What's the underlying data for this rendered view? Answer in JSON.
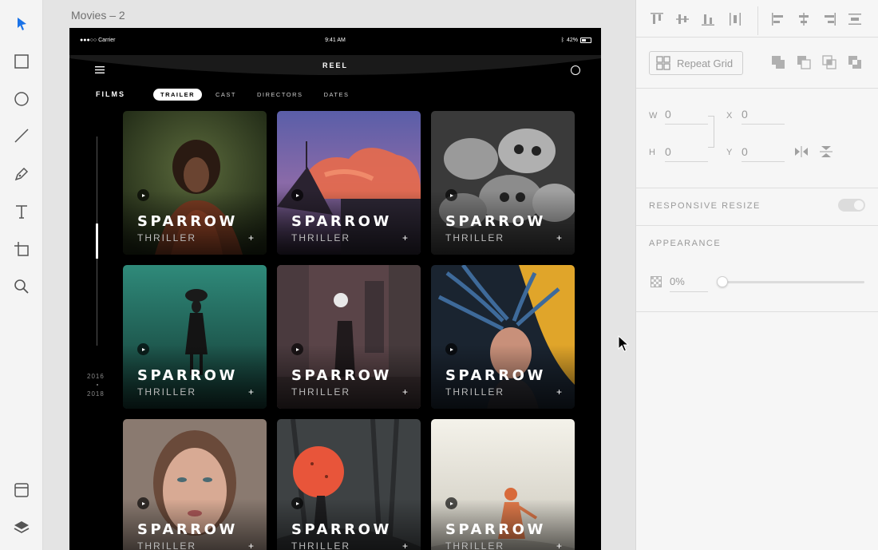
{
  "toolbar": {
    "tools": [
      {
        "name": "select-tool-icon",
        "active": true
      },
      {
        "name": "rectangle-tool-icon"
      },
      {
        "name": "ellipse-tool-icon"
      },
      {
        "name": "line-tool-icon"
      },
      {
        "name": "pen-tool-icon"
      },
      {
        "name": "text-tool-icon"
      },
      {
        "name": "artboard-tool-icon"
      },
      {
        "name": "zoom-tool-icon"
      }
    ],
    "bottom_tools": [
      {
        "name": "assets-panel-icon"
      },
      {
        "name": "layers-panel-icon"
      }
    ],
    "accent": "#1a73e8"
  },
  "canvas": {
    "artboard_title": "Movies – 2"
  },
  "app": {
    "status": {
      "carrier": "●●●○○ Carrier",
      "time": "9:41 AM",
      "battery": "42%"
    },
    "title": "REEL",
    "section_label": "FILMS",
    "tabs": [
      {
        "label": "TRAILER",
        "active": true
      },
      {
        "label": "CAST"
      },
      {
        "label": "DIRECTORS"
      },
      {
        "label": "DATES"
      }
    ],
    "timeline": {
      "start": "2016",
      "end": "2018"
    },
    "cards": [
      {
        "title": "SPARROW",
        "genre": "THRILLER",
        "plus": "+"
      },
      {
        "title": "SPARROW",
        "genre": "THRILLER",
        "plus": "+"
      },
      {
        "title": "SPARROW",
        "genre": "THRILLER",
        "plus": "+"
      },
      {
        "title": "SPARROW",
        "genre": "THRILLER",
        "plus": "+"
      },
      {
        "title": "SPARROW",
        "genre": "THRILLER",
        "plus": "+"
      },
      {
        "title": "SPARROW",
        "genre": "THRILLER",
        "plus": "+"
      },
      {
        "title": "SPARROW",
        "genre": "THRILLER",
        "plus": "+"
      },
      {
        "title": "SPARROW",
        "genre": "THRILLER",
        "plus": "+"
      },
      {
        "title": "SPARROW",
        "genre": "THRILLER",
        "plus": "+"
      }
    ]
  },
  "inspector": {
    "repeat_grid_label": "Repeat Grid",
    "w_label": "W",
    "w_value": "0",
    "h_label": "H",
    "h_value": "0",
    "x_label": "X",
    "x_value": "0",
    "y_label": "Y",
    "y_value": "0",
    "responsive_resize_label": "RESPONSIVE RESIZE",
    "appearance_label": "APPEARANCE",
    "opacity_value": "0%",
    "opacity_fraction": 0
  }
}
